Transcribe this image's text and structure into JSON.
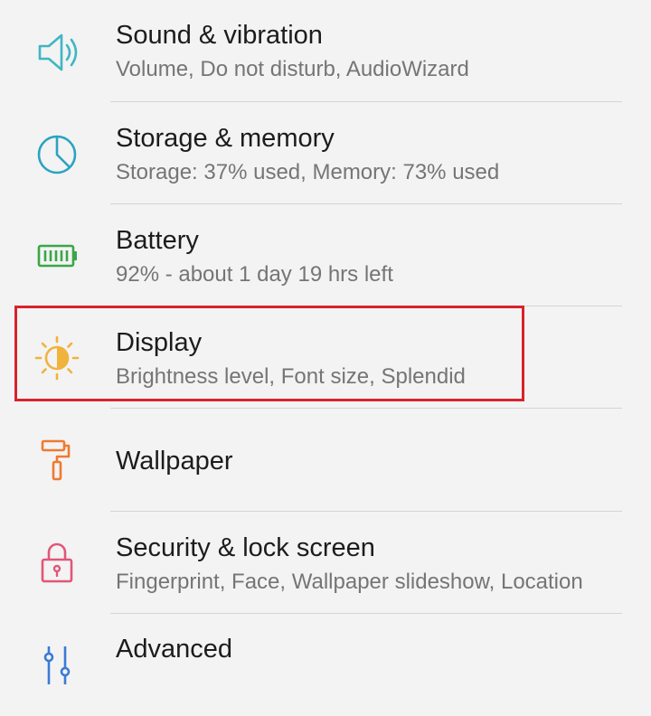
{
  "settings": {
    "items": [
      {
        "title": "Sound & vibration",
        "subtitle": "Volume, Do not disturb, AudioWizard",
        "icon": "speaker-icon"
      },
      {
        "title": "Storage & memory",
        "subtitle": "Storage: 37% used, Memory: 73% used",
        "icon": "pie-chart-icon"
      },
      {
        "title": "Battery",
        "subtitle": "92% - about 1 day 19 hrs left",
        "icon": "battery-icon"
      },
      {
        "title": "Display",
        "subtitle": "Brightness level, Font size, Splendid",
        "icon": "brightness-icon"
      },
      {
        "title": "Wallpaper",
        "subtitle": "",
        "icon": "paint-roller-icon"
      },
      {
        "title": "Security & lock screen",
        "subtitle": "Fingerprint, Face, Wallpaper slideshow, Location",
        "icon": "lock-icon"
      },
      {
        "title": "Advanced",
        "subtitle": "",
        "icon": "advanced-icon"
      }
    ]
  },
  "colors": {
    "background": "#f3f3f3",
    "title": "#1c1c1c",
    "subtitle": "#757575",
    "divider": "#d4d4d4",
    "highlight": "#d8232a",
    "sound_icon": "#3fb6c3",
    "storage_icon": "#2aa3c2",
    "battery_icon": "#3aa648",
    "display_icon": "#f0b33c",
    "wallpaper_icon": "#ef7a30",
    "lock_icon": "#e05779",
    "advanced_icon": "#3a7bd5"
  }
}
